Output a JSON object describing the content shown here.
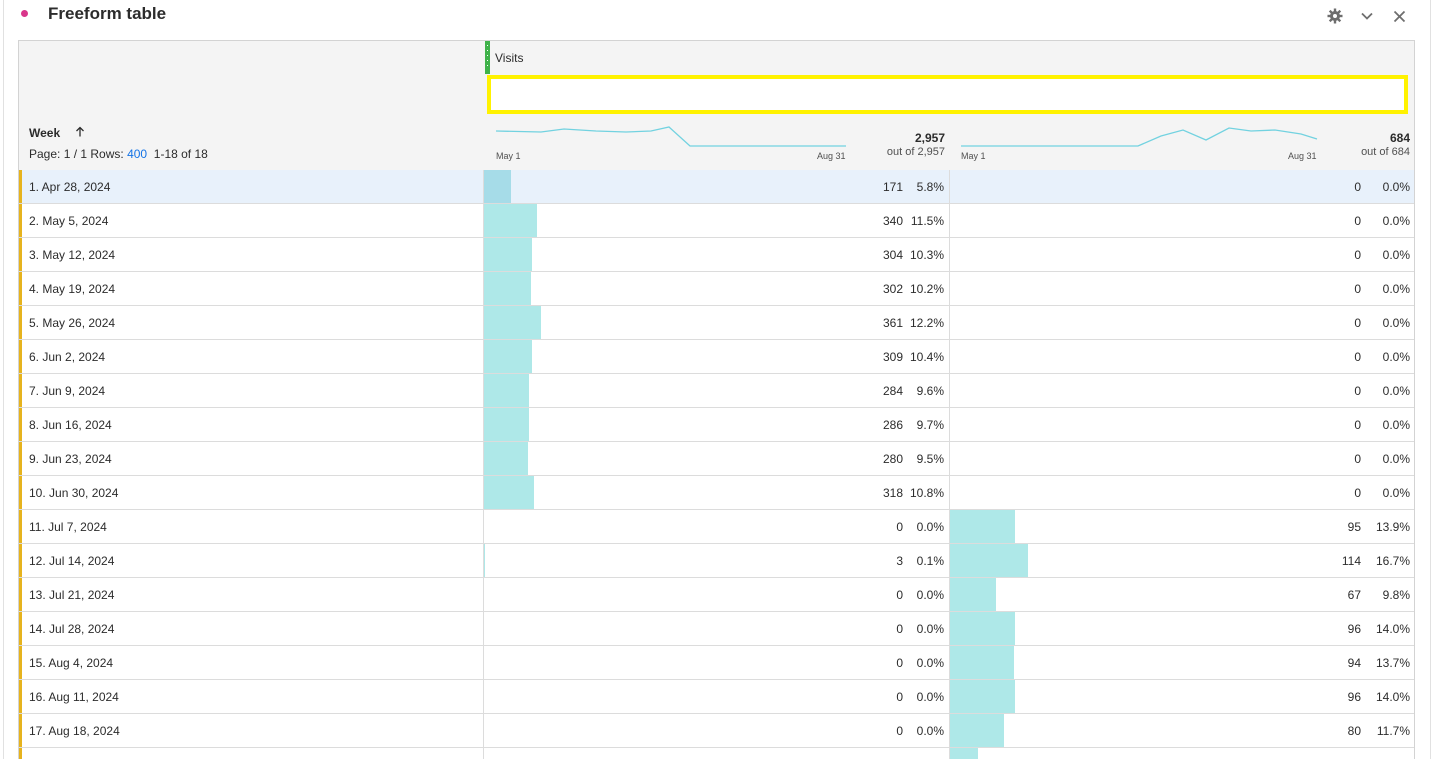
{
  "panel": {
    "title": "Freeform table",
    "icons": [
      "gear-icon",
      "chevron-down-icon",
      "close-icon"
    ]
  },
  "table": {
    "metric_name": "Visits",
    "dimension_label": "Week",
    "page_label": "Page: 1 / 1",
    "rows_label": "Rows:",
    "rows_value": "400",
    "range_label": "1-18 of 18",
    "col1": {
      "spark_start": "May 1",
      "spark_end": "Aug 31",
      "total": "2,957",
      "total_sub": "out of 2,957"
    },
    "col2": {
      "spark_start": "May 1",
      "spark_end": "Aug 31",
      "total": "684",
      "total_sub": "out of 684"
    },
    "colors": {
      "bar": "#aee8e8",
      "sparkline": "#72d2e0",
      "row_marker": "#e6b31e",
      "selection": "#fff200"
    },
    "rows": [
      {
        "label": "1.  Apr 28, 2024",
        "v1": "171",
        "p1": "5.8%",
        "f1": 0.058,
        "v2": "0",
        "p2": "0.0%",
        "f2": 0
      },
      {
        "label": "2.  May 5, 2024",
        "v1": "340",
        "p1": "11.5%",
        "f1": 0.115,
        "v2": "0",
        "p2": "0.0%",
        "f2": 0
      },
      {
        "label": "3.  May 12, 2024",
        "v1": "304",
        "p1": "10.3%",
        "f1": 0.103,
        "v2": "0",
        "p2": "0.0%",
        "f2": 0
      },
      {
        "label": "4.  May 19, 2024",
        "v1": "302",
        "p1": "10.2%",
        "f1": 0.102,
        "v2": "0",
        "p2": "0.0%",
        "f2": 0
      },
      {
        "label": "5.  May 26, 2024",
        "v1": "361",
        "p1": "12.2%",
        "f1": 0.122,
        "v2": "0",
        "p2": "0.0%",
        "f2": 0
      },
      {
        "label": "6.  Jun 2, 2024",
        "v1": "309",
        "p1": "10.4%",
        "f1": 0.104,
        "v2": "0",
        "p2": "0.0%",
        "f2": 0
      },
      {
        "label": "7.  Jun 9, 2024",
        "v1": "284",
        "p1": "9.6%",
        "f1": 0.096,
        "v2": "0",
        "p2": "0.0%",
        "f2": 0
      },
      {
        "label": "8.  Jun 16, 2024",
        "v1": "286",
        "p1": "9.7%",
        "f1": 0.097,
        "v2": "0",
        "p2": "0.0%",
        "f2": 0
      },
      {
        "label": "9.  Jun 23, 2024",
        "v1": "280",
        "p1": "9.5%",
        "f1": 0.095,
        "v2": "0",
        "p2": "0.0%",
        "f2": 0
      },
      {
        "label": "10.  Jun 30, 2024",
        "v1": "318",
        "p1": "10.8%",
        "f1": 0.108,
        "v2": "0",
        "p2": "0.0%",
        "f2": 0
      },
      {
        "label": "11.  Jul 7, 2024",
        "v1": "0",
        "p1": "0.0%",
        "f1": 0,
        "v2": "95",
        "p2": "13.9%",
        "f2": 0.139
      },
      {
        "label": "12.  Jul 14, 2024",
        "v1": "3",
        "p1": "0.1%",
        "f1": 0.001,
        "v2": "114",
        "p2": "16.7%",
        "f2": 0.167
      },
      {
        "label": "13.  Jul 21, 2024",
        "v1": "0",
        "p1": "0.0%",
        "f1": 0,
        "v2": "67",
        "p2": "9.8%",
        "f2": 0.098
      },
      {
        "label": "14.  Jul 28, 2024",
        "v1": "0",
        "p1": "0.0%",
        "f1": 0,
        "v2": "96",
        "p2": "14.0%",
        "f2": 0.14
      },
      {
        "label": "15.  Aug 4, 2024",
        "v1": "0",
        "p1": "0.0%",
        "f1": 0,
        "v2": "94",
        "p2": "13.7%",
        "f2": 0.137
      },
      {
        "label": "16.  Aug 11, 2024",
        "v1": "0",
        "p1": "0.0%",
        "f1": 0,
        "v2": "96",
        "p2": "14.0%",
        "f2": 0.14
      },
      {
        "label": "17.  Aug 18, 2024",
        "v1": "0",
        "p1": "0.0%",
        "f1": 0,
        "v2": "80",
        "p2": "11.7%",
        "f2": 0.117
      },
      {
        "label": "",
        "v1": "",
        "p1": "",
        "f1": 0,
        "v2": "",
        "p2": "",
        "f2": 0.06
      }
    ]
  }
}
